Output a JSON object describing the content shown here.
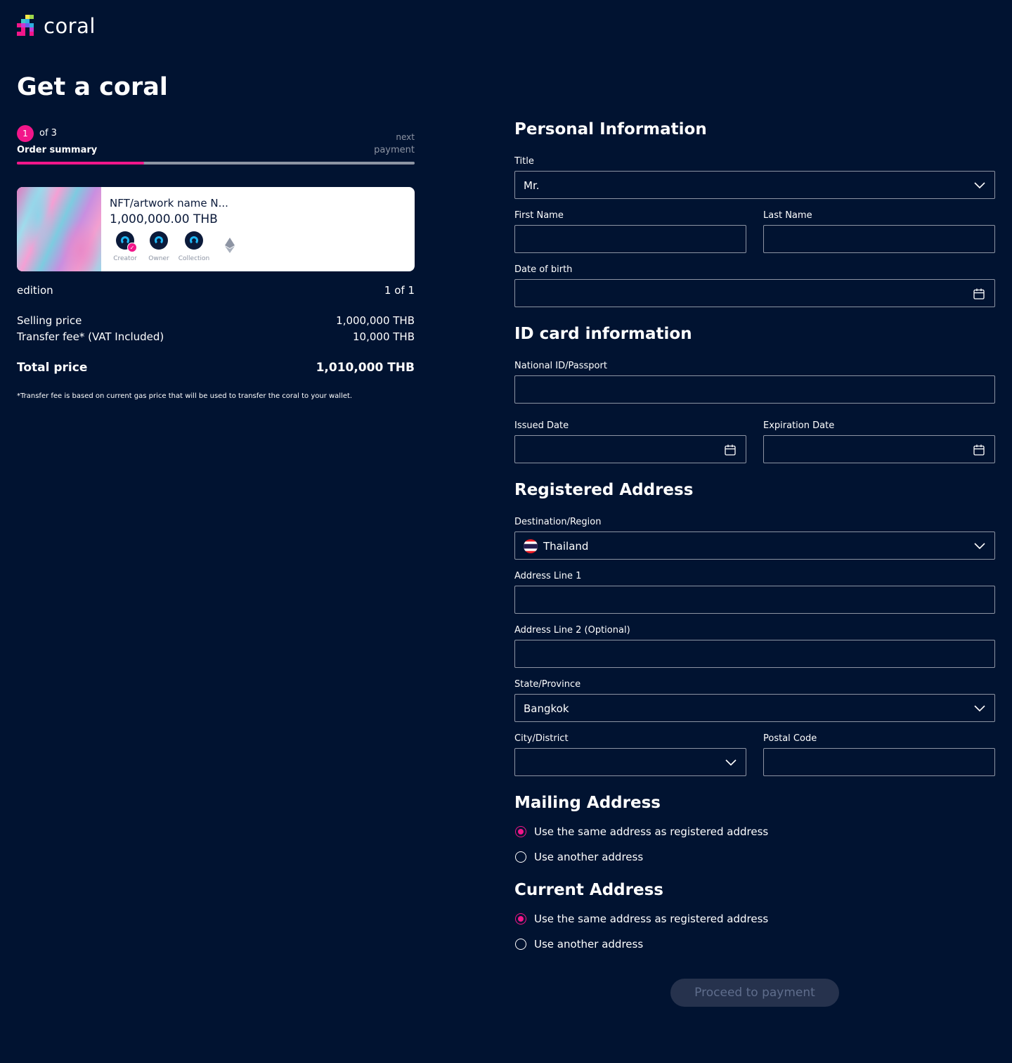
{
  "brand": {
    "logo_text": "coral"
  },
  "page_title": "Get a coral",
  "stepper": {
    "current": "1",
    "of_text": "of 3",
    "current_label": "Order summary",
    "next_caption": "next",
    "next_label": "payment",
    "progress": 0.32
  },
  "nft": {
    "name": "NFT/artwork name N...",
    "price": "1,000,000.00 THB",
    "avatars": [
      {
        "label": "Creator"
      },
      {
        "label": "Owner"
      },
      {
        "label": "Collection"
      }
    ],
    "chain_icon": "ethereum-icon"
  },
  "summary": {
    "edition_label": "edition",
    "edition_value": "1 of 1",
    "selling_label": "Selling price",
    "selling_value": "1,000,000 THB",
    "fee_label": "Transfer fee* (VAT Included)",
    "fee_value": "10,000 THB",
    "total_label": "Total price",
    "total_value": "1,010,000 THB",
    "footnote": "*Transfer fee is based on current gas price that will be used to transfer the coral to your wallet."
  },
  "personal": {
    "heading": "Personal Information",
    "title_label": "Title",
    "title_value": "Mr.",
    "first_name_label": "First Name",
    "first_name_value": "",
    "last_name_label": "Last Name",
    "last_name_value": "",
    "dob_label": "Date of birth",
    "dob_value": ""
  },
  "id_card": {
    "heading": "ID card information",
    "national_label": "National ID/Passport",
    "national_value": "",
    "issued_label": "Issued Date",
    "issued_value": "",
    "expiration_label": "Expiration Date",
    "expiration_value": ""
  },
  "registered": {
    "heading": "Registered Address",
    "destination_label": "Destination/Region",
    "destination_value": "Thailand",
    "address1_label": "Address Line 1",
    "address1_value": "",
    "address2_label": "Address Line 2 (Optional)",
    "address2_value": "",
    "state_label": "State/Province",
    "state_value": "Bangkok",
    "city_label": "City/District",
    "city_value": "",
    "postal_label": "Postal Code",
    "postal_value": ""
  },
  "mailing": {
    "heading": "Mailing Address",
    "option_same": "Use the same address as registered address",
    "option_other": "Use another address",
    "selected": "same"
  },
  "current": {
    "heading": "Current Address",
    "option_same": "Use the same address as registered address",
    "option_other": "Use another address",
    "selected": "same"
  },
  "proceed_button": "Proceed to payment",
  "colors": {
    "background": "#011331",
    "accent": "#f2168a",
    "muted": "#8d94a3",
    "button_disabled_bg": "#26324d",
    "button_disabled_text": "#5f6d8c"
  }
}
